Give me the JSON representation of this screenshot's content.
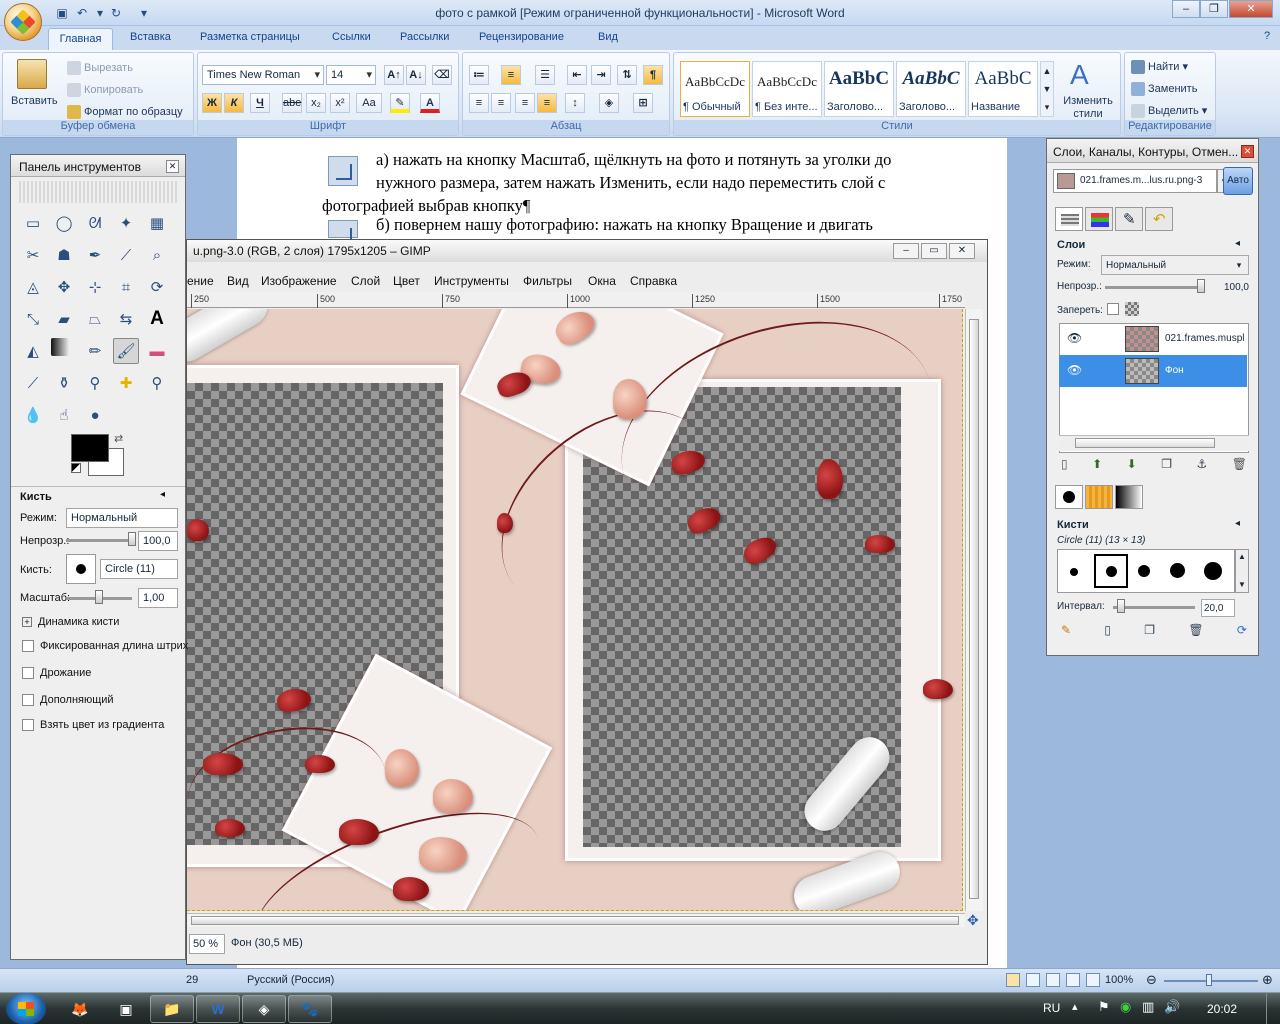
{
  "word": {
    "title": "фото с рамкой [Режим ограниченной функциональности] - Microsoft Word",
    "tabs": [
      "Главная",
      "Вставка",
      "Разметка страницы",
      "Ссылки",
      "Рассылки",
      "Рецензирование",
      "Вид"
    ],
    "clipboard": {
      "paste": "Вставить",
      "cut": "Вырезать",
      "copy": "Копировать",
      "format_painter": "Формат по образцу",
      "label": "Буфер обмена"
    },
    "font": {
      "name": "Times New Roman",
      "size": "14",
      "label": "Шрифт",
      "bold": "Ж",
      "italic": "К",
      "underline": "Ч",
      "strike": "abe",
      "sub": "x₂",
      "sup": "x²",
      "case": "Aa"
    },
    "paragraph": {
      "label": "Абзац"
    },
    "styles": {
      "label": "Стили",
      "items": [
        {
          "sample": "AaBbCcDc",
          "name": "¶ Обычный"
        },
        {
          "sample": "AaBbCcDc",
          "name": "¶ Без инте..."
        },
        {
          "sample": "AaBbC",
          "name": "Заголово..."
        },
        {
          "sample": "AaBbC",
          "name": "Заголово..."
        },
        {
          "sample": "AaBbC",
          "name": "Название"
        }
      ],
      "change_styles": "Изменить стили"
    },
    "editing": {
      "find": "Найти",
      "replace": "Заменить",
      "select": "Выделить",
      "label": "Редактирование"
    },
    "doc_lines": [
      "а) нажать на кнопку Масштаб, щёлкнуть на фото и потянуть за уголки до",
      "нужного размера, затем нажать Изменить, если надо переместить слой с",
      "фотографией выбрав кнопку¶",
      "б) повернем нашу фотографию: нажать на кнопку Вращение и двигать"
    ],
    "status": {
      "page": "29",
      "language": "Русский (Россия)",
      "zoom": "100%"
    }
  },
  "toolbox": {
    "title": "Панель инструментов",
    "tools": [
      "rect-select",
      "ellipse-select",
      "lasso",
      "fuzzy-select",
      "select-by-color",
      "scissors",
      "foreground-select",
      "paths",
      "color-picker",
      "zoom",
      "measure",
      "move",
      "align",
      "crop",
      "rotate",
      "scale",
      "shear",
      "perspective",
      "flip",
      "text",
      "bucket-fill",
      "blend",
      "pencil",
      "paintbrush",
      "eraser",
      "airbrush",
      "ink",
      "clone",
      "heal",
      "perspective-clone",
      "smudge",
      "blur",
      "dodge-burn"
    ],
    "active_tool": "paintbrush",
    "options": {
      "title": "Кисть",
      "mode_label": "Режим:",
      "mode": "Нормальный",
      "opacity_label": "Непрозр.:",
      "opacity": "100,0",
      "opacity_value": 100,
      "brush_label": "Кисть:",
      "brush": "Circle (11)",
      "scale_label": "Масштаб:",
      "scale": "1,00",
      "scale_fraction": 0.5,
      "dynamics": "Динамика кисти",
      "checks": [
        "Фиксированная длина штрих",
        "Дрожание",
        "Дополняющий",
        "Взять цвет из градиента"
      ]
    }
  },
  "gimp": {
    "title": "u.png-3.0 (RGB, 2 слоя) 1795x1205 – GIMP",
    "menu": [
      "ение",
      "Вид",
      "Изображение",
      "Слой",
      "Цвет",
      "Инструменты",
      "Фильтры",
      "Окна",
      "Справка"
    ],
    "ruler": [
      "250",
      "500",
      "750",
      "1000",
      "1250",
      "1500",
      "1750"
    ],
    "zoom": "50 %",
    "status": "Фон (30,5 МБ)"
  },
  "layers": {
    "title": "Слои, Каналы, Контуры, Отмен...",
    "image": "021.frames.m...lus.ru.png-3",
    "auto": "Авто",
    "section": "Слои",
    "mode_label": "Режим:",
    "mode": "Нормальный",
    "opacity_label": "Непрозр.:",
    "opacity": "100,0",
    "opacity_value": 100,
    "lock_label": "Запереть:",
    "items": [
      {
        "name": "021.frames.musplus"
      },
      {
        "name": "Фон"
      }
    ],
    "brushes": {
      "title": "Кисти",
      "current": "Circle (11) (13 × 13)",
      "interval_label": "Интервал:",
      "interval": "20,0",
      "interval_value": 20
    }
  },
  "taskbar": {
    "lang": "RU",
    "time": "20:02"
  }
}
